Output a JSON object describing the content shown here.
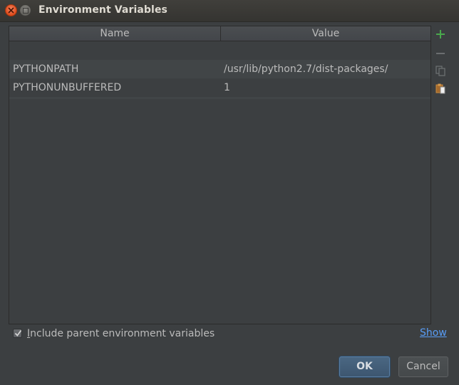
{
  "window": {
    "title": "Environment Variables"
  },
  "table": {
    "columns": [
      "Name",
      "Value"
    ],
    "rows": [
      {
        "name": "",
        "value": ""
      },
      {
        "name": "PYTHONPATH",
        "value": "/usr/lib/python2.7/dist-packages/"
      },
      {
        "name": "PYTHONUNBUFFERED",
        "value": "1"
      }
    ]
  },
  "toolbar": {
    "icons": [
      "add-icon",
      "remove-icon",
      "copy-icon",
      "paste-icon"
    ]
  },
  "options": {
    "include_parent_mnemonic": "I",
    "include_parent_rest": "nclude parent environment variables",
    "include_parent_checked": true,
    "show_link": "Show"
  },
  "buttons": {
    "ok": "OK",
    "cancel": "Cancel"
  },
  "colors": {
    "background": "#3c3f41",
    "text": "#bbbbbb",
    "link": "#589df6",
    "add_green": "#49a84c",
    "close_button": "#df4a1b"
  }
}
